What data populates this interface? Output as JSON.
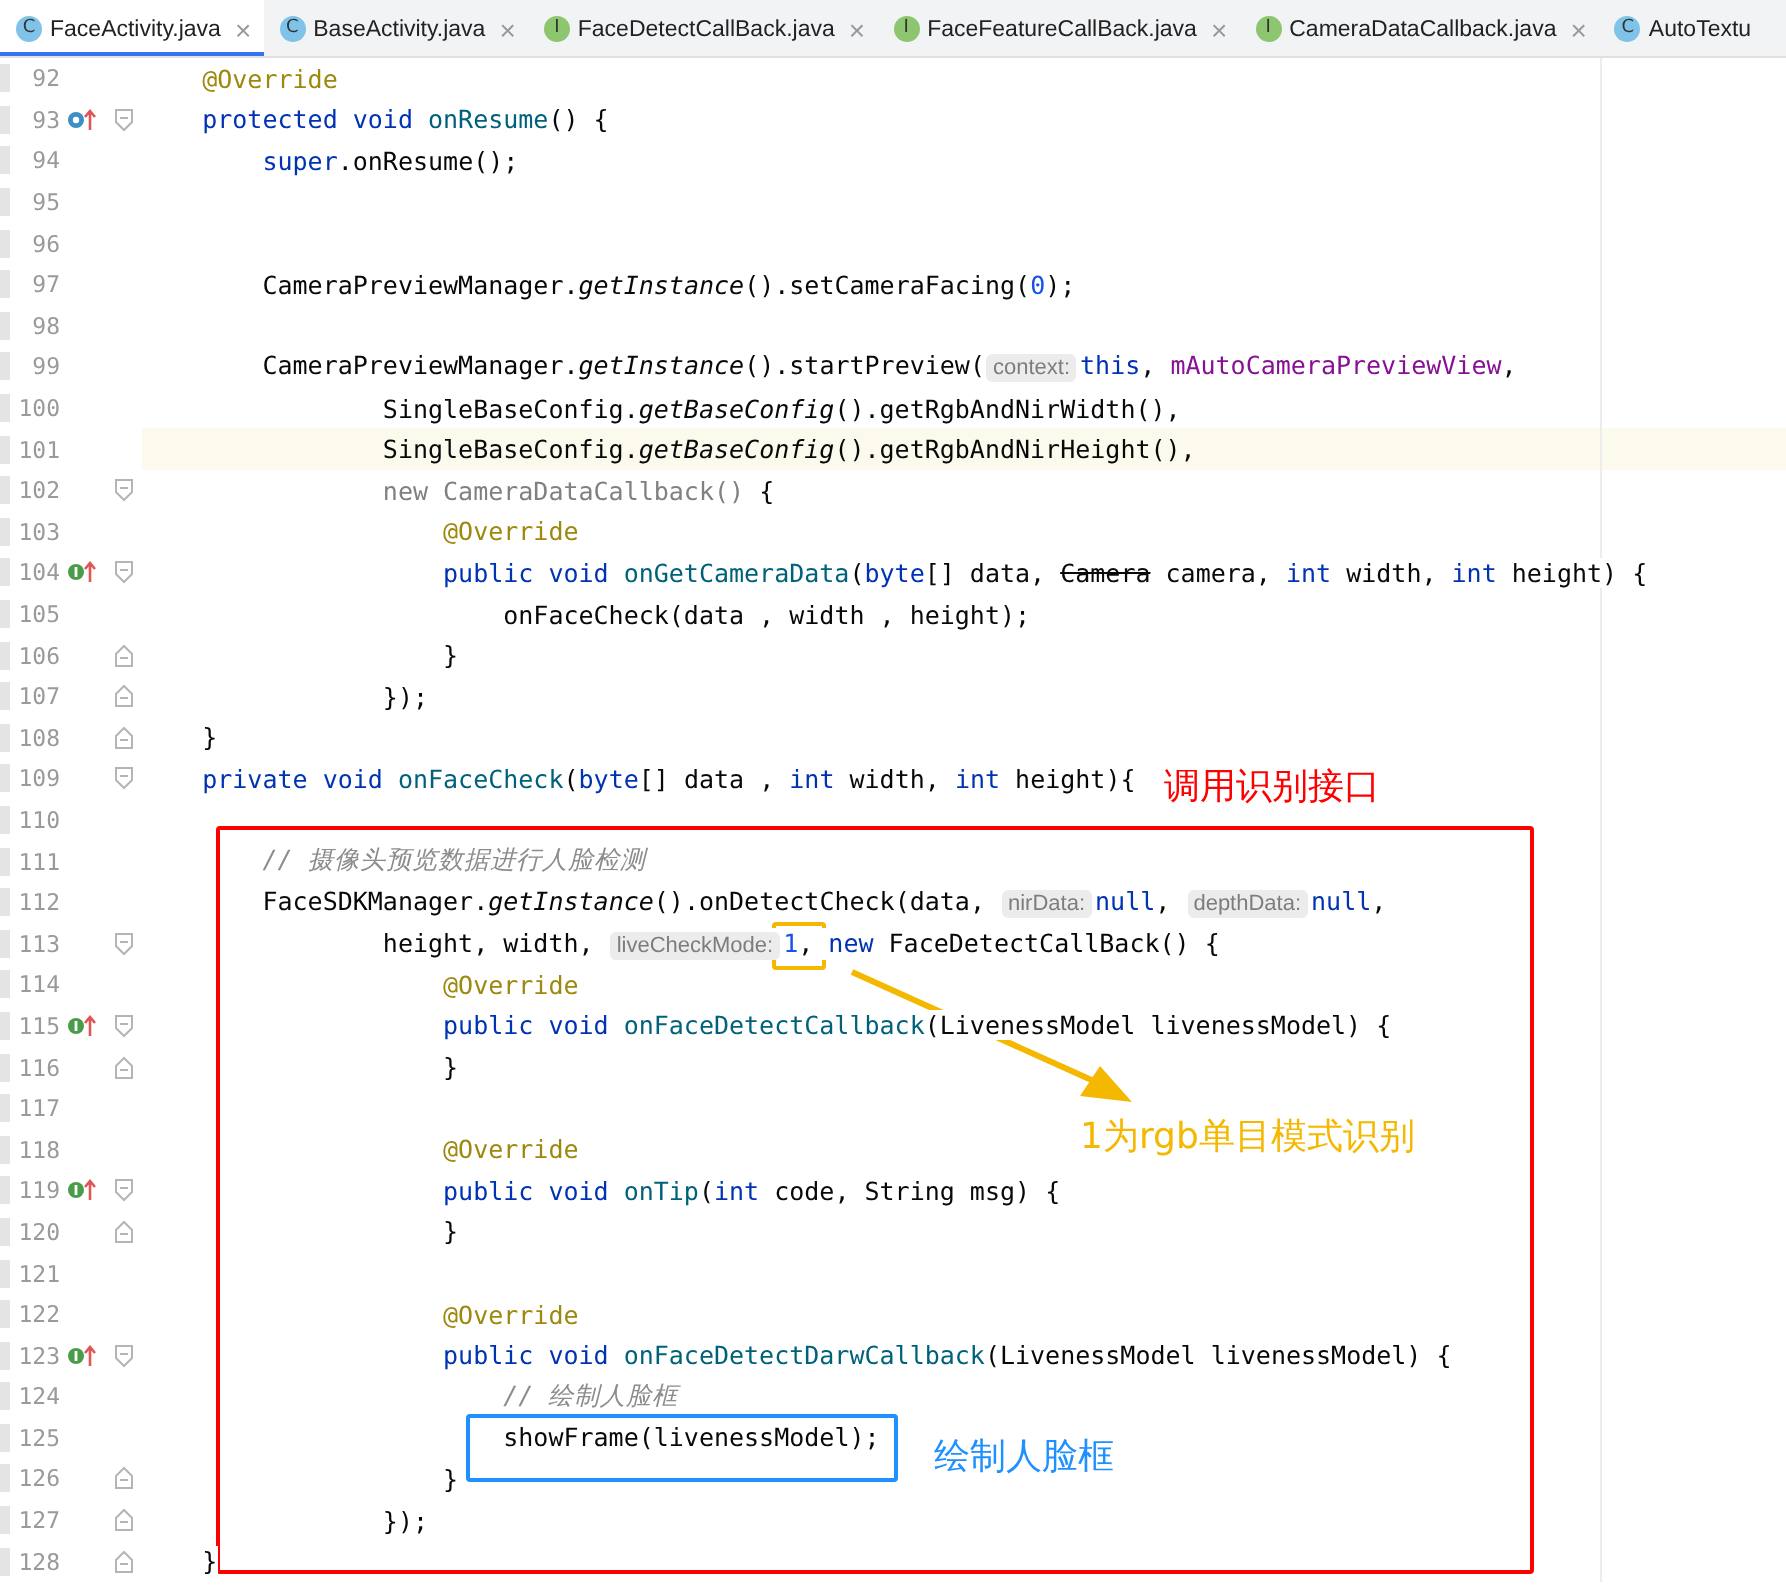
{
  "tabs": [
    {
      "icon": "C",
      "kind": "class",
      "label": "FaceActivity.java",
      "selected": true,
      "closable": true
    },
    {
      "icon": "C",
      "kind": "class",
      "label": "BaseActivity.java",
      "selected": false,
      "closable": true
    },
    {
      "icon": "I",
      "kind": "interface",
      "label": "FaceDetectCallBack.java",
      "selected": false,
      "closable": true
    },
    {
      "icon": "I",
      "kind": "interface",
      "label": "FaceFeatureCallBack.java",
      "selected": false,
      "closable": true
    },
    {
      "icon": "I",
      "kind": "interface",
      "label": "CameraDataCallback.java",
      "selected": false,
      "closable": true
    },
    {
      "icon": "C",
      "kind": "class",
      "label": "AutoTextu",
      "selected": false,
      "closable": false
    }
  ],
  "close_glyph": "×",
  "lines": [
    {
      "number": "92",
      "selected": false,
      "tokens": [
        {
          "kind": "annotation",
          "text": "    @Override"
        }
      ]
    },
    {
      "number": "93",
      "overrides": true,
      "fold_start": true,
      "selected": false,
      "tokens": [
        {
          "kind": "keyword",
          "text": "    protected void "
        },
        {
          "kind": "declaration",
          "text": "onResume"
        },
        {
          "kind": "plain",
          "text": "() {"
        }
      ]
    },
    {
      "number": "94",
      "selected": false,
      "tokens": [
        {
          "kind": "keyword",
          "text": "        super"
        },
        {
          "kind": "plain",
          "text": ".onResume();"
        }
      ]
    },
    {
      "number": "95",
      "selected": false
    },
    {
      "number": "96",
      "selected": false
    },
    {
      "number": "97",
      "selected": false,
      "tokens": [
        {
          "kind": "plain",
          "text": "        CameraPreviewManager."
        },
        {
          "kind": "static",
          "text": "getInstance"
        },
        {
          "kind": "plain",
          "text": "().setCameraFacing("
        },
        {
          "kind": "number",
          "text": "0"
        },
        {
          "kind": "plain",
          "text": ");"
        }
      ]
    },
    {
      "number": "98",
      "selected": false
    },
    {
      "number": "99",
      "selected": false,
      "tokens": [
        {
          "kind": "plain",
          "text": "        CameraPreviewManager."
        },
        {
          "kind": "static",
          "text": "getInstance"
        },
        {
          "kind": "plain",
          "text": "().startPreview("
        },
        {
          "kind": "hint",
          "text": "context:"
        },
        {
          "kind": "keyword",
          "text": "this"
        },
        {
          "kind": "plain",
          "text": ", "
        },
        {
          "kind": "field",
          "text": "mAutoCameraPreviewView"
        },
        {
          "kind": "plain",
          "text": ","
        }
      ]
    },
    {
      "number": "100",
      "selected": false,
      "tokens": [
        {
          "kind": "plain",
          "text": "                SingleBaseConfig."
        },
        {
          "kind": "static",
          "text": "getBaseConfig"
        },
        {
          "kind": "plain",
          "text": "().getRgbAndNirWidth(),"
        }
      ]
    },
    {
      "number": "101",
      "selected": true,
      "tokens": [
        {
          "kind": "plain",
          "text": "                SingleBaseConfig."
        },
        {
          "kind": "static",
          "text": "getBaseConfig"
        },
        {
          "kind": "plain",
          "text": "().getRgbAndNirHeight(),"
        }
      ]
    },
    {
      "number": "102",
      "fold_start": true,
      "selected": false,
      "tokens": [
        {
          "kind": "muted",
          "text": "                new CameraDataCallback()"
        },
        {
          "kind": "plain",
          "text": " {"
        }
      ]
    },
    {
      "number": "103",
      "selected": false,
      "tokens": [
        {
          "kind": "annotation",
          "text": "                    @Override"
        }
      ]
    },
    {
      "number": "104",
      "implements": true,
      "fold_start": true,
      "selected": false,
      "tokens": [
        {
          "kind": "keyword",
          "text": "                    public void "
        },
        {
          "kind": "declaration",
          "text": "onGetCameraData"
        },
        {
          "kind": "plain",
          "text": "("
        },
        {
          "kind": "keyword",
          "text": "byte"
        },
        {
          "kind": "plain",
          "text": "[] data, "
        },
        {
          "kind": "deprecated",
          "text": "Camera"
        },
        {
          "kind": "plain",
          "text": " camera, "
        },
        {
          "kind": "keyword",
          "text": "int"
        },
        {
          "kind": "plain",
          "text": " width, "
        },
        {
          "kind": "keyword",
          "text": "int"
        },
        {
          "kind": "plain",
          "text": " height) {"
        }
      ]
    },
    {
      "number": "105",
      "selected": false,
      "tokens": [
        {
          "kind": "plain",
          "text": "                        onFaceCheck(data , width , height);"
        }
      ]
    },
    {
      "number": "106",
      "fold_end": true,
      "selected": false,
      "tokens": [
        {
          "kind": "plain",
          "text": "                    }"
        }
      ]
    },
    {
      "number": "107",
      "fold_end": true,
      "selected": false,
      "tokens": [
        {
          "kind": "plain",
          "text": "                });"
        }
      ]
    },
    {
      "number": "108",
      "fold_end": true,
      "selected": false,
      "tokens": [
        {
          "kind": "plain",
          "text": "    }"
        }
      ]
    },
    {
      "number": "109",
      "fold_start": true,
      "selected": false,
      "tokens": [
        {
          "kind": "keyword",
          "text": "    private void "
        },
        {
          "kind": "declaration",
          "text": "onFaceCheck"
        },
        {
          "kind": "plain",
          "text": "("
        },
        {
          "kind": "keyword",
          "text": "byte"
        },
        {
          "kind": "plain",
          "text": "[] data , "
        },
        {
          "kind": "keyword",
          "text": "int"
        },
        {
          "kind": "plain",
          "text": " width, "
        },
        {
          "kind": "keyword",
          "text": "int"
        },
        {
          "kind": "plain",
          "text": " height){"
        }
      ]
    },
    {
      "number": "110",
      "selected": false
    },
    {
      "number": "111",
      "selected": false,
      "tokens": [
        {
          "kind": "comment",
          "text": "        // 摄像头预览数据进行人脸检测"
        }
      ]
    },
    {
      "number": "112",
      "selected": false,
      "tokens": [
        {
          "kind": "plain",
          "text": "        FaceSDKManager."
        },
        {
          "kind": "static",
          "text": "getInstance"
        },
        {
          "kind": "plain",
          "text": "().onDetectCheck(data, "
        },
        {
          "kind": "hint",
          "text": "nirData:"
        },
        {
          "kind": "keyword",
          "text": "null"
        },
        {
          "kind": "plain",
          "text": ", "
        },
        {
          "kind": "hint",
          "text": "depthData:"
        },
        {
          "kind": "keyword",
          "text": "null"
        },
        {
          "kind": "plain",
          "text": ","
        }
      ]
    },
    {
      "number": "113",
      "fold_start": true,
      "selected": false,
      "tokens": [
        {
          "kind": "plain",
          "text": "                height, width, "
        },
        {
          "kind": "hint",
          "text": "liveCheckMode:"
        },
        {
          "kind": "number",
          "text": "1"
        },
        {
          "kind": "plain",
          "text": ", "
        },
        {
          "kind": "keyword",
          "text": "new "
        },
        {
          "kind": "plain",
          "text": "FaceDetectCallBack() {"
        }
      ]
    },
    {
      "number": "114",
      "selected": false,
      "tokens": [
        {
          "kind": "annotation",
          "text": "                    @Override"
        }
      ]
    },
    {
      "number": "115",
      "implements": true,
      "fold_start": true,
      "selected": false,
      "tokens": [
        {
          "kind": "keyword",
          "text": "                    public void "
        },
        {
          "kind": "declaration",
          "text": "onFaceDetectCallback"
        },
        {
          "kind": "plain",
          "text": "(LivenessModel livenessModel) {"
        }
      ]
    },
    {
      "number": "116",
      "fold_end": true,
      "selected": false,
      "tokens": [
        {
          "kind": "plain",
          "text": "                    }"
        }
      ]
    },
    {
      "number": "117",
      "selected": false
    },
    {
      "number": "118",
      "selected": false,
      "tokens": [
        {
          "kind": "annotation",
          "text": "                    @Override"
        }
      ]
    },
    {
      "number": "119",
      "implements": true,
      "fold_start": true,
      "selected": false,
      "tokens": [
        {
          "kind": "keyword",
          "text": "                    public void "
        },
        {
          "kind": "declaration",
          "text": "onTip"
        },
        {
          "kind": "plain",
          "text": "("
        },
        {
          "kind": "keyword",
          "text": "int"
        },
        {
          "kind": "plain",
          "text": " code, String msg) {"
        }
      ]
    },
    {
      "number": "120",
      "fold_end": true,
      "selected": false,
      "tokens": [
        {
          "kind": "plain",
          "text": "                    }"
        }
      ]
    },
    {
      "number": "121",
      "selected": false
    },
    {
      "number": "122",
      "selected": false,
      "tokens": [
        {
          "kind": "annotation",
          "text": "                    @Override"
        }
      ]
    },
    {
      "number": "123",
      "implements": true,
      "fold_start": true,
      "selected": false,
      "tokens": [
        {
          "kind": "keyword",
          "text": "                    public void "
        },
        {
          "kind": "declaration",
          "text": "onFaceDetectDarwCallback"
        },
        {
          "kind": "plain",
          "text": "(LivenessModel livenessModel) {"
        }
      ]
    },
    {
      "number": "124",
      "selected": false,
      "tokens": [
        {
          "kind": "comment",
          "text": "                        // 绘制人脸框"
        }
      ]
    },
    {
      "number": "125",
      "selected": false,
      "tokens": [
        {
          "kind": "plain",
          "text": "                        showFrame(livenessModel);"
        }
      ]
    },
    {
      "number": "126",
      "fold_end": true,
      "selected": false,
      "tokens": [
        {
          "kind": "plain",
          "text": "                    }"
        }
      ]
    },
    {
      "number": "127",
      "fold_end": true,
      "selected": false,
      "tokens": [
        {
          "kind": "plain",
          "text": "                });"
        }
      ]
    },
    {
      "number": "128",
      "fold_end": true,
      "selected": false,
      "tokens": [
        {
          "kind": "plain",
          "text": "    }"
        }
      ]
    }
  ],
  "annotations": [
    {
      "kind": "box",
      "color": "#ff0000"
    },
    {
      "kind": "label",
      "text": "调用识别接口",
      "color": "#ff0000"
    },
    {
      "kind": "box",
      "color": "#f5b800"
    },
    {
      "kind": "arrow",
      "color": "#f5b800"
    },
    {
      "kind": "label",
      "text": "1为rgb单目模式识别",
      "color": "#f5b800"
    },
    {
      "kind": "box",
      "color": "#1e90ff"
    },
    {
      "kind": "label",
      "text": "绘制人脸框",
      "color": "#1e90ff"
    }
  ]
}
